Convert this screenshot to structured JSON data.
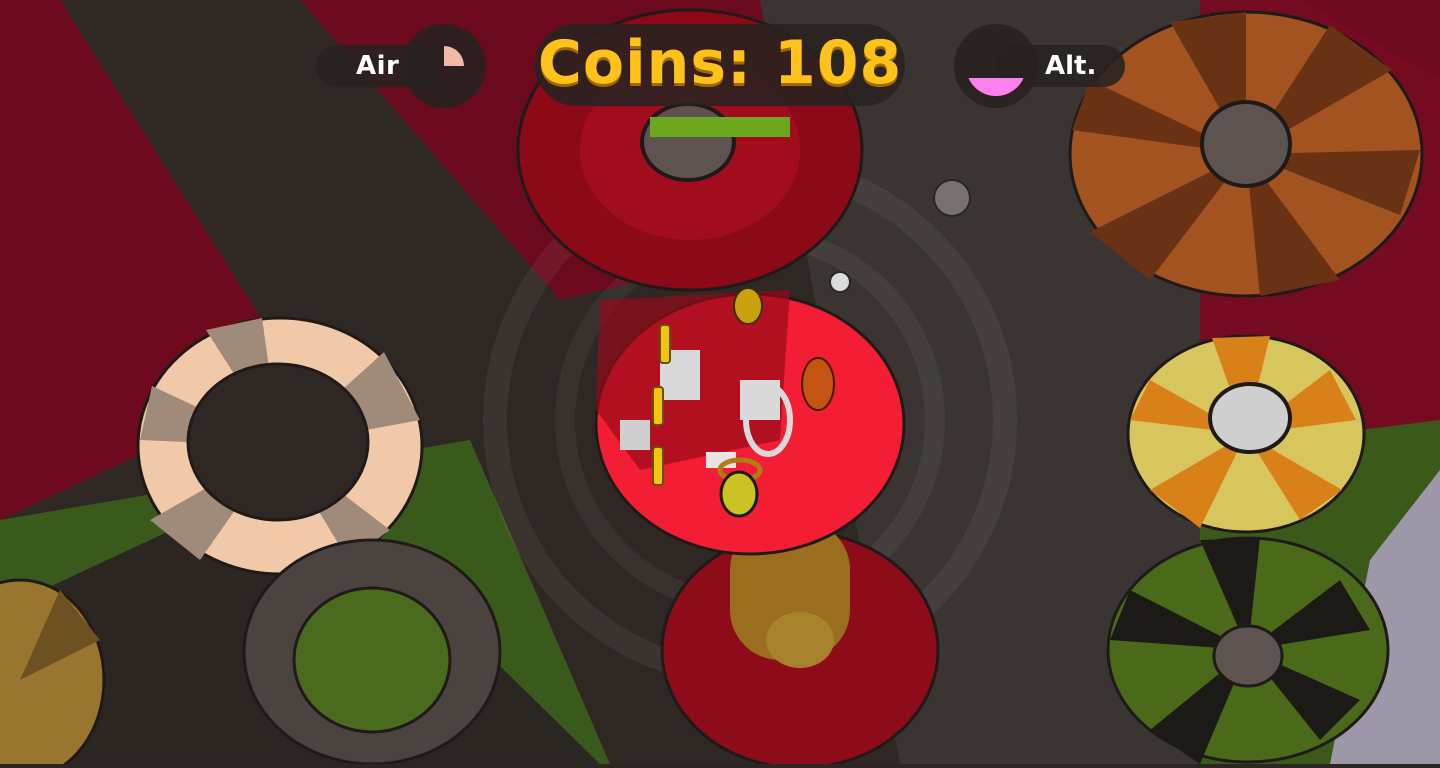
{
  "hud": {
    "air_label": "Air",
    "coins_label": "Coins: 108",
    "alt_label": "Alt."
  },
  "air_gauge": {
    "level": 0.25,
    "color": "#f2b9a6"
  },
  "alt_gauge": {
    "level": 0.3,
    "color": "#ff80ec"
  },
  "progress": {
    "level": 1.0,
    "color": "#6da71f"
  },
  "colors": {
    "coin_text": "#ffc21a",
    "background_red": "#6e0a1e",
    "ground_green": "#3a5a1c"
  }
}
